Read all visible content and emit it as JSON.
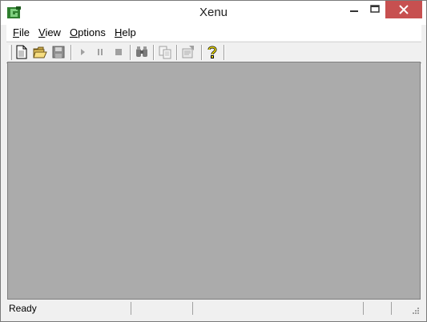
{
  "window": {
    "title": "Xenu"
  },
  "menu": [
    {
      "pre": "",
      "key": "F",
      "post": "ile"
    },
    {
      "pre": "",
      "key": "V",
      "post": "iew"
    },
    {
      "pre": "",
      "key": "O",
      "post": "ptions"
    },
    {
      "pre": "",
      "key": "H",
      "post": "elp"
    }
  ],
  "toolbar": {
    "icons": [
      "new-document-icon",
      "open-folder-icon",
      "save-icon",
      "play-icon",
      "pause-icon",
      "stop-icon",
      "find-binoculars-icon",
      "copy-icon",
      "properties-icon",
      "help-question-icon"
    ]
  },
  "status": {
    "text": "Ready"
  },
  "colors": {
    "client_bg": "#ababab",
    "close_button": "#c75050",
    "window_bg": "#f0f0f0"
  }
}
